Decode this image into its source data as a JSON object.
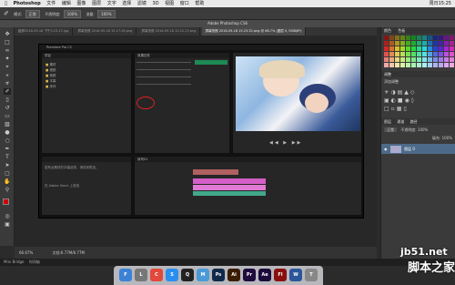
{
  "menubar": {
    "app_name": "Photoshop",
    "items": [
      "文件",
      "编辑",
      "图像",
      "图层",
      "文字",
      "选择",
      "滤镜",
      "3D",
      "视图",
      "窗口",
      "帮助"
    ],
    "clock": "周日15:25"
  },
  "options_bar": {
    "mode_label": "模式:",
    "mode_value": "正常",
    "opacity_label": "不透明度:",
    "opacity_value": "100%",
    "flow_label": "流量:",
    "flow_value": "100%"
  },
  "window_title": "Adobe Photoshop CS6",
  "doc_tabs": [
    "截屏2016-09-18 下午3.15.27.jpg",
    "屏幕快照 2016-09-18 15.17.28.png",
    "屏幕快照 2016-09-18 15.22.23.png",
    "屏幕快照 2016-09-18 15.23.32.png @ 66.7% (图层 0, RGB/8*)"
  ],
  "status_bar": {
    "zoom": "66.67%",
    "doc_info": "文档:6.77M/6.77M"
  },
  "mini_bridge_label": "Mini Bridge",
  "mini_bridge_tab2": "时间轴",
  "right_panel": {
    "tab_color": "颜色",
    "tab_swatches": "色板",
    "tab_adjust": "调整",
    "adjust_title": "添加调整",
    "tab_layers": "图层",
    "tab_channels": "通道",
    "tab_paths": "路径",
    "blend_mode": "正常",
    "opacity_label": "不透明度:",
    "opacity": "100%",
    "fill_label": "填充:",
    "fill": "100%",
    "layer_name": "图层 0"
  },
  "premiere": {
    "title": "Premiere Pro CC",
    "project_tab": "项目",
    "effect_controls_tab": "效果控件",
    "timeline_tab": "序列01",
    "info_text": "若有此素材的字幕选项，请将其附加。",
    "info_text2": "在 Adobe Stock 上查找",
    "folders": [
      "素材",
      "视频",
      "音频",
      "字幕",
      "序列"
    ]
  },
  "dock_icons": [
    {
      "name": "finder",
      "color": "#3b82d6",
      "label": "F"
    },
    {
      "name": "launchpad",
      "color": "#777",
      "label": "L"
    },
    {
      "name": "chrome",
      "color": "#e2483b",
      "label": "C"
    },
    {
      "name": "safari",
      "color": "#2a8ef0",
      "label": "S"
    },
    {
      "name": "qq",
      "color": "#222",
      "label": "Q"
    },
    {
      "name": "mail",
      "color": "#4a9ad8",
      "label": "M"
    },
    {
      "name": "photoshop",
      "color": "#0f2a4a",
      "label": "Ps"
    },
    {
      "name": "illustrator",
      "color": "#3a1c00",
      "label": "Ai"
    },
    {
      "name": "premiere",
      "color": "#1e0a3c",
      "label": "Pr"
    },
    {
      "name": "aftereffects",
      "color": "#1b0a3a",
      "label": "Ae"
    },
    {
      "name": "flash",
      "color": "#8a1010",
      "label": "Fl"
    },
    {
      "name": "word",
      "color": "#2b579a",
      "label": "W"
    },
    {
      "name": "trash",
      "color": "#888",
      "label": "T"
    }
  ],
  "watermark": {
    "site": "jb51.net",
    "brand": "脚本之家"
  }
}
